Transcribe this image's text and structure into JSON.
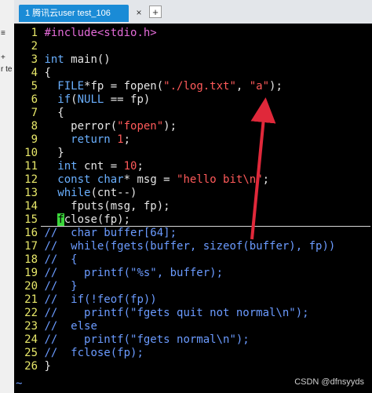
{
  "left_panel": {
    "label_1": "≡",
    "label_2": "r te",
    "label_3": "+"
  },
  "tab": {
    "title": "1 腾讯云user test_106",
    "close": "×",
    "add": "+"
  },
  "lines": [
    {
      "n": "1",
      "segs": [
        [
          "inc",
          "#include<stdio.h>"
        ]
      ]
    },
    {
      "n": "2",
      "segs": []
    },
    {
      "n": "3",
      "segs": [
        [
          "kw",
          "int"
        ],
        [
          "code",
          " main()"
        ]
      ]
    },
    {
      "n": "4",
      "segs": [
        [
          "code",
          "{"
        ]
      ]
    },
    {
      "n": "5",
      "segs": [
        [
          "code",
          "  "
        ],
        [
          "kw",
          "FILE"
        ],
        [
          "code",
          "*fp = fopen("
        ],
        [
          "str",
          "\"./log.txt\""
        ],
        [
          "code",
          ", "
        ],
        [
          "str",
          "\"a\""
        ],
        [
          "code",
          ");"
        ]
      ]
    },
    {
      "n": "6",
      "segs": [
        [
          "code",
          "  "
        ],
        [
          "kw",
          "if"
        ],
        [
          "code",
          "("
        ],
        [
          "kw",
          "NULL"
        ],
        [
          "code",
          " == fp)"
        ]
      ]
    },
    {
      "n": "7",
      "segs": [
        [
          "code",
          "  {"
        ]
      ]
    },
    {
      "n": "8",
      "segs": [
        [
          "code",
          "    perror("
        ],
        [
          "str",
          "\"fopen\""
        ],
        [
          "code",
          ");"
        ]
      ]
    },
    {
      "n": "9",
      "segs": [
        [
          "code",
          "    "
        ],
        [
          "kw",
          "return"
        ],
        [
          "code",
          " "
        ],
        [
          "num",
          "1"
        ],
        [
          "code",
          ";"
        ]
      ]
    },
    {
      "n": "10",
      "segs": [
        [
          "code",
          "  }"
        ]
      ]
    },
    {
      "n": "11",
      "segs": [
        [
          "code",
          "  "
        ],
        [
          "kw",
          "int"
        ],
        [
          "code",
          " cnt = "
        ],
        [
          "num",
          "10"
        ],
        [
          "code",
          ";"
        ]
      ]
    },
    {
      "n": "12",
      "segs": [
        [
          "code",
          "  "
        ],
        [
          "kw",
          "const"
        ],
        [
          "code",
          " "
        ],
        [
          "kw",
          "char"
        ],
        [
          "code",
          "* msg = "
        ],
        [
          "str",
          "\"hello bit\\n\""
        ],
        [
          "code",
          ";"
        ]
      ]
    },
    {
      "n": "13",
      "segs": [
        [
          "code",
          "  "
        ],
        [
          "kw",
          "while"
        ],
        [
          "code",
          "(cnt--)"
        ]
      ]
    },
    {
      "n": "14",
      "segs": [
        [
          "code",
          "    fputs(msg, fp);"
        ]
      ]
    },
    {
      "n": "15",
      "segs": [
        [
          "code",
          "  "
        ],
        [
          "cursor",
          "f"
        ],
        [
          "code",
          "close(fp);"
        ]
      ]
    },
    {
      "n": "16",
      "segs": [
        [
          "cmt",
          "//  char buffer[64];"
        ]
      ]
    },
    {
      "n": "17",
      "segs": [
        [
          "cmt",
          "//  while(fgets(buffer, sizeof(buffer), fp))"
        ]
      ]
    },
    {
      "n": "18",
      "segs": [
        [
          "cmt",
          "//  {"
        ]
      ]
    },
    {
      "n": "19",
      "segs": [
        [
          "cmt",
          "//    printf(\"%s\", buffer);"
        ]
      ]
    },
    {
      "n": "20",
      "segs": [
        [
          "cmt",
          "//  }"
        ]
      ]
    },
    {
      "n": "21",
      "segs": [
        [
          "cmt",
          "//  if(!feof(fp))"
        ]
      ]
    },
    {
      "n": "22",
      "segs": [
        [
          "cmt",
          "//    printf(\"fgets quit not normal\\n\");"
        ]
      ]
    },
    {
      "n": "23",
      "segs": [
        [
          "cmt",
          "//  else"
        ]
      ]
    },
    {
      "n": "24",
      "segs": [
        [
          "cmt",
          "//    printf(\"fgets normal\\n\");"
        ]
      ]
    },
    {
      "n": "25",
      "segs": [
        [
          "cmt",
          "//  fclose(fp);"
        ]
      ]
    },
    {
      "n": "26",
      "segs": [
        [
          "code",
          "}"
        ]
      ]
    }
  ],
  "tilde": "~",
  "watermark": "CSDN @dfnsyyds",
  "colors": {
    "tab_active": "#1a8bd6",
    "annotation_arrow": "#e0283a",
    "keyword": "#6ab0ff",
    "string": "#ff5a5a",
    "comment": "#6b9bff",
    "line_number": "#e8e86a"
  }
}
